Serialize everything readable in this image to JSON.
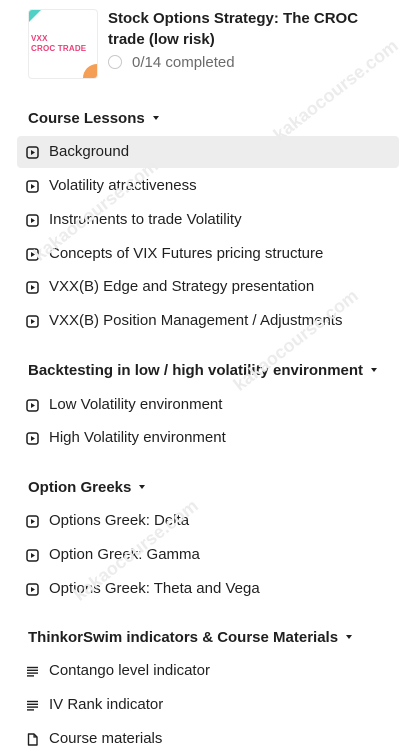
{
  "course": {
    "title": "Stock Options Strategy: The CROC trade (low risk)",
    "progress_text": "0/14 completed",
    "thumbnail": {
      "line1": "VXX",
      "line2": "CROC TRADE"
    }
  },
  "colors": {
    "active_bg": "#ededed",
    "accent_pink": "#e9407a",
    "accent_teal": "#4fd1c5",
    "accent_orange": "#f59e56"
  },
  "watermark": "kakaocourse.com",
  "sections": [
    {
      "title": "Course Lessons",
      "lessons": [
        {
          "label": "Background",
          "icon": "video-icon",
          "active": true
        },
        {
          "label": "Volatility atractiveness",
          "icon": "video-icon"
        },
        {
          "label": "Instruments to trade Volatility",
          "icon": "video-icon"
        },
        {
          "label": "Concepts of VIX Futures pricing structure",
          "icon": "video-icon"
        },
        {
          "label": "VXX(B) Edge and Strategy presentation",
          "icon": "video-icon"
        },
        {
          "label": "VXX(B) Position Management / Adjustments",
          "icon": "video-icon"
        }
      ]
    },
    {
      "title": "Backtesting in low / high volatility environment",
      "lessons": [
        {
          "label": "Low Volatility environment",
          "icon": "video-icon"
        },
        {
          "label": "High Volatility environment",
          "icon": "video-icon"
        }
      ]
    },
    {
      "title": "Option Greeks",
      "lessons": [
        {
          "label": "Options Greek: Delta",
          "icon": "video-icon"
        },
        {
          "label": "Option Greek: Gamma",
          "icon": "video-icon"
        },
        {
          "label": "Options Greek: Theta and Vega",
          "icon": "video-icon"
        }
      ]
    },
    {
      "title": "ThinkorSwim indicators & Course Materials",
      "lessons": [
        {
          "label": "Contango level indicator",
          "icon": "text-lines-icon"
        },
        {
          "label": "IV Rank indicator",
          "icon": "text-lines-icon"
        },
        {
          "label": "Course materials",
          "icon": "document-icon"
        }
      ]
    }
  ]
}
